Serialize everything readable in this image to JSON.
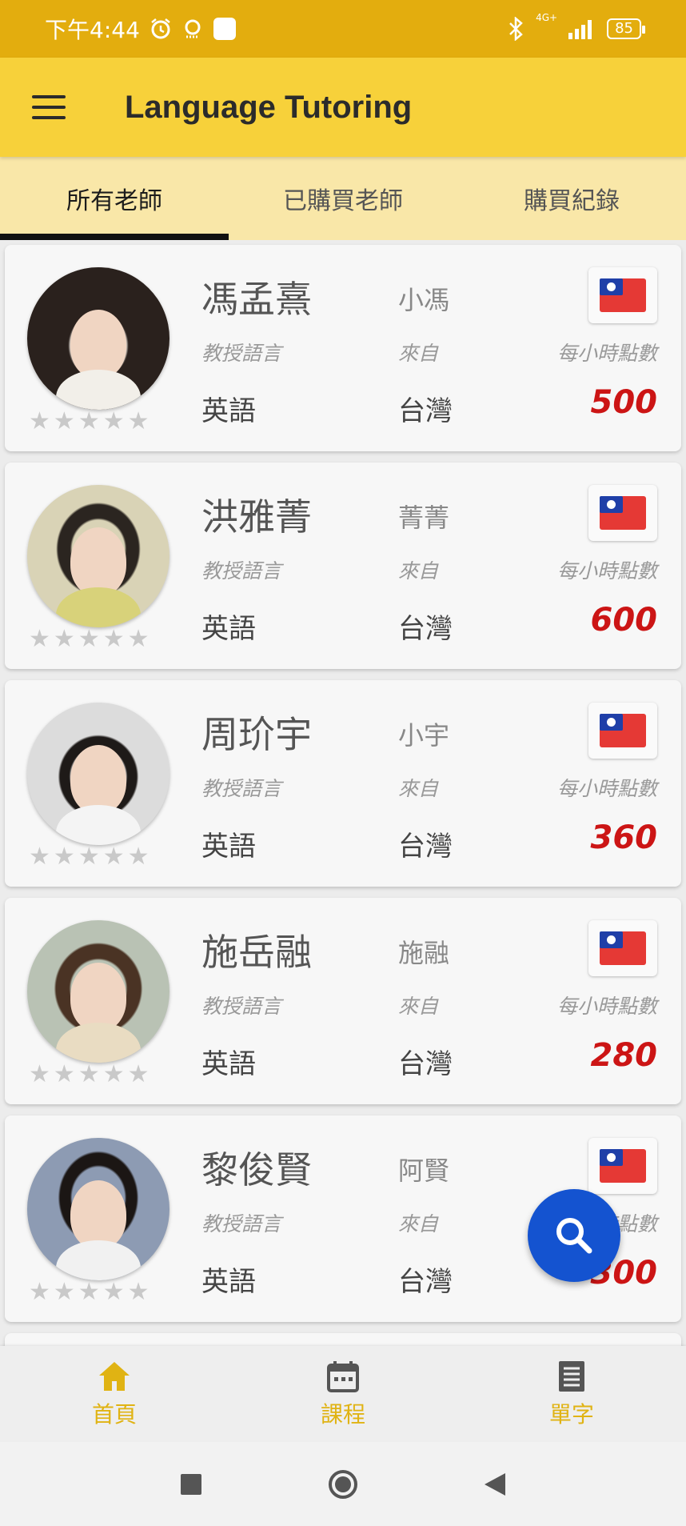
{
  "status_bar": {
    "time": "下午4:44",
    "network": "4G+",
    "battery": "85"
  },
  "app_bar": {
    "title": "Language Tutoring"
  },
  "tabs": [
    {
      "label": "所有老師",
      "active": true
    },
    {
      "label": "已購買老師",
      "active": false
    },
    {
      "label": "購買紀錄",
      "active": false
    }
  ],
  "labels": {
    "language": "教授語言",
    "from": "來自",
    "points": "每小時點數"
  },
  "teachers": [
    {
      "name": "馮孟熹",
      "nickname": "小馮",
      "language": "英語",
      "country": "台灣",
      "points": "500",
      "rating": 0
    },
    {
      "name": "洪雅菁",
      "nickname": "菁菁",
      "language": "英語",
      "country": "台灣",
      "points": "600",
      "rating": 0
    },
    {
      "name": "周玠宇",
      "nickname": "小宇",
      "language": "英語",
      "country": "台灣",
      "points": "360",
      "rating": 0
    },
    {
      "name": "施岳融",
      "nickname": "施融",
      "language": "英語",
      "country": "台灣",
      "points": "280",
      "rating": 0
    },
    {
      "name": "黎俊賢",
      "nickname": "阿賢",
      "language": "英語",
      "country": "台灣",
      "points": "300",
      "rating": 0
    }
  ],
  "bottom_nav": [
    {
      "label": "首頁",
      "icon": "home-icon"
    },
    {
      "label": "課程",
      "icon": "calendar-icon"
    },
    {
      "label": "單字",
      "icon": "document-icon"
    }
  ],
  "colors": {
    "status_bar": "#e3ad0e",
    "app_bar": "#f7d13a",
    "tabs_bg": "#f9e7a8",
    "price": "#cc1515",
    "fab": "#1453d0",
    "nav_accent": "#e0b313"
  }
}
